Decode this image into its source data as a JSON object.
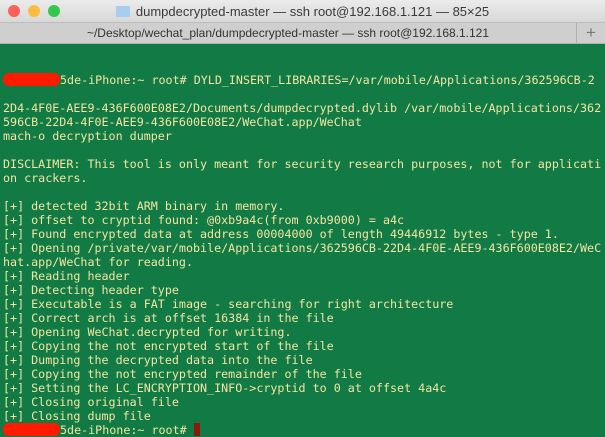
{
  "window": {
    "title": "dumpdecrypted-master — ssh root@192.168.1.121 — 85×25",
    "tab": "~/Desktop/wechat_plan/dumpdecrypted-master — ssh root@192.168.1.121",
    "new_tab": "+",
    "colors": {
      "background": "#127a45",
      "text": "#f2e6a2",
      "close": "#fc605b",
      "minimize": "#fdbc40",
      "zoom": "#34c84a"
    }
  },
  "terminal": {
    "prompt": "5de-iPhone:~ root# ",
    "first_command": "DYLD_INSERT_LIBRARIES=/var/mobile/Applications/362596CB-2",
    "lines": [
      "2D4-4F0E-AEE9-436F600E08E2/Documents/dumpdecrypted.dylib /var/mobile/Applications/362",
      "596CB-22D4-4F0E-AEE9-436F600E08E2/WeChat.app/WeChat",
      "mach-o decryption dumper",
      "",
      "DISCLAIMER: This tool is only meant for security research purposes, not for applicati",
      "on crackers.",
      "",
      "[+] detected 32bit ARM binary in memory.",
      "[+] offset to cryptid found: @0xb9a4c(from 0xb9000) = a4c",
      "[+] Found encrypted data at address 00004000 of length 49446912 bytes - type 1.",
      "[+] Opening /private/var/mobile/Applications/362596CB-22D4-4F0E-AEE9-436F600E08E2/WeC",
      "hat.app/WeChat for reading.",
      "[+] Reading header",
      "[+] Detecting header type",
      "[+] Executable is a FAT image - searching for right architecture",
      "[+] Correct arch is at offset 16384 in the file",
      "[+] Opening WeChat.decrypted for writing.",
      "[+] Copying the not encrypted start of the file",
      "[+] Dumping the decrypted data into the file",
      "[+] Copying the not encrypted remainder of the file",
      "[+] Setting the LC_ENCRYPTION_INFO->cryptid to 0 at offset 4a4c",
      "[+] Closing original file",
      "[+] Closing dump file"
    ]
  }
}
